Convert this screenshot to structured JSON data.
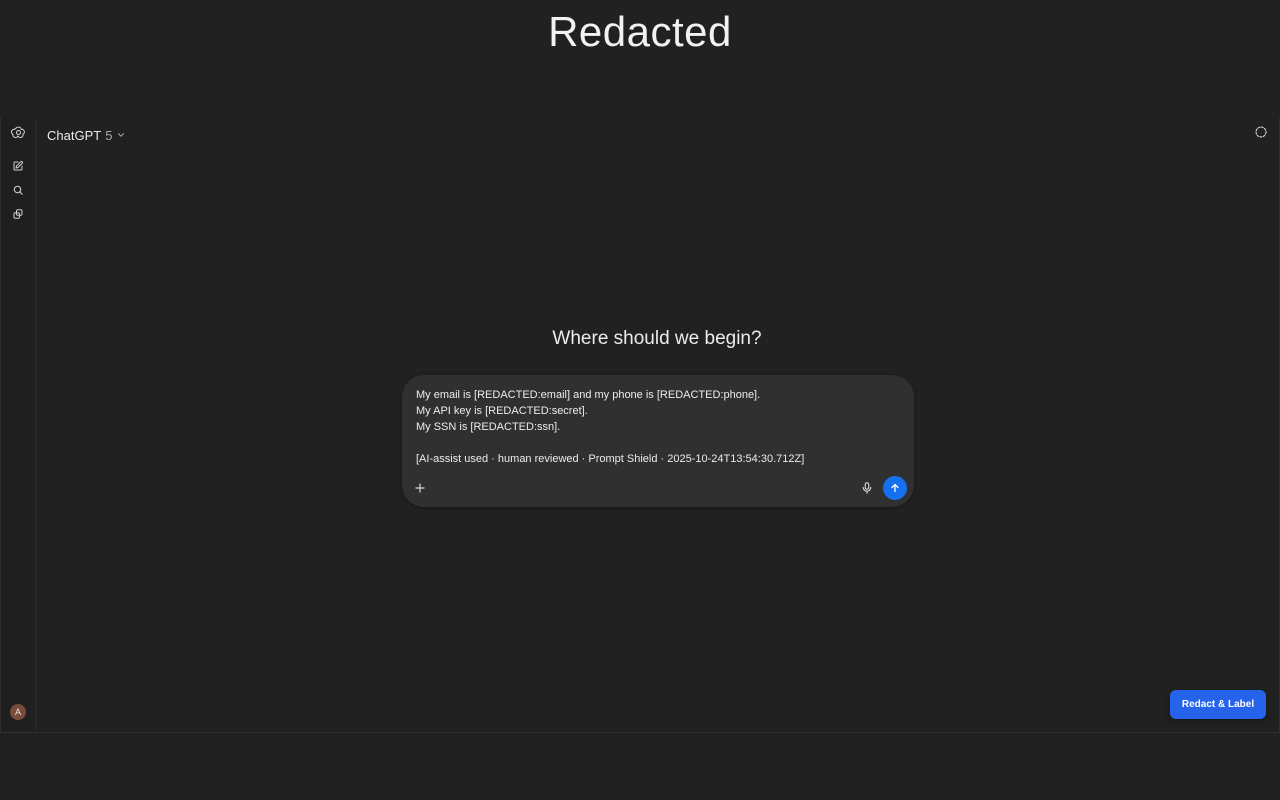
{
  "banner": {
    "title": "Redacted"
  },
  "header": {
    "model_name": "ChatGPT",
    "model_version": "5"
  },
  "main": {
    "heading": "Where should we begin?"
  },
  "composer": {
    "text": "My email is [REDACTED:email] and my phone is [REDACTED:phone].\nMy API key is [REDACTED:secret].\nMy SSN is [REDACTED:ssn].\n\n[AI-assist used · human reviewed · Prompt Shield · 2025-10-24T13:54:30.712Z]"
  },
  "sidebar": {
    "avatar_initial": "A"
  },
  "extension": {
    "button_label": "Redact & Label"
  },
  "colors": {
    "background": "#212121",
    "composer": "#303030",
    "send": "#1570ef",
    "action": "#2563eb"
  },
  "icons": [
    "openai-logo-icon",
    "new-chat-icon",
    "search-icon",
    "library-icon",
    "chevron-down-icon",
    "temporary-chat-icon",
    "plus-icon",
    "microphone-icon",
    "arrow-up-icon"
  ]
}
